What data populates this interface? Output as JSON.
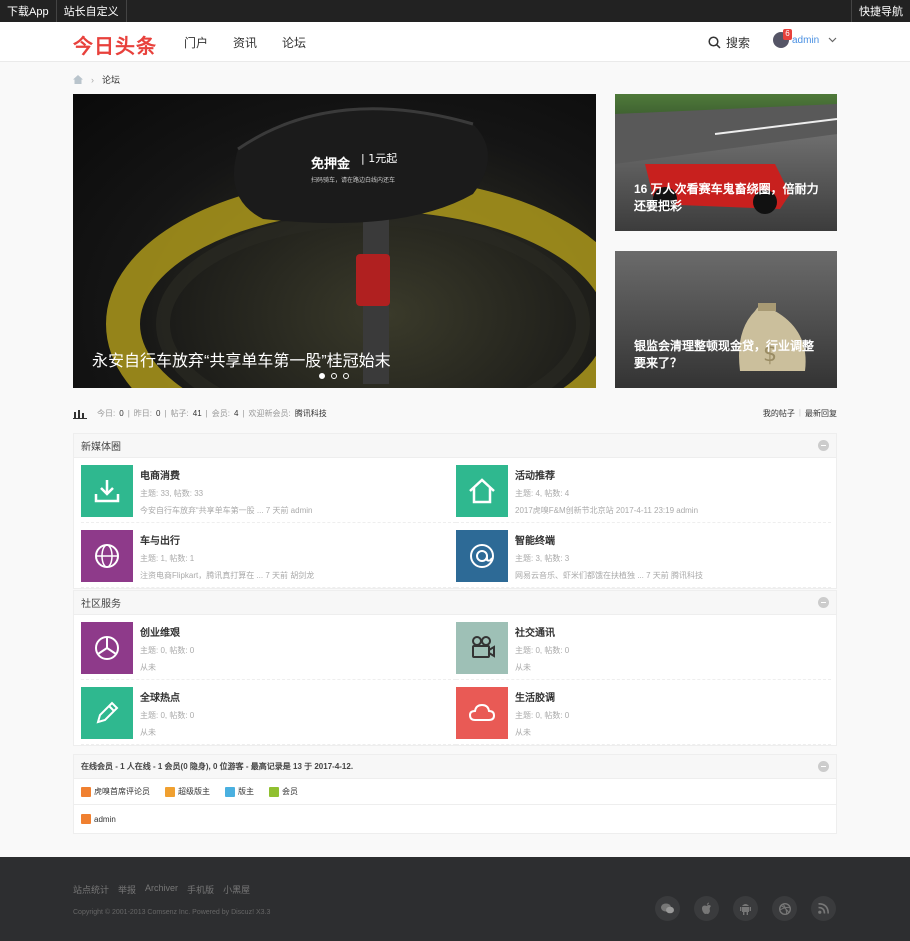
{
  "topbar": {
    "download": "下载App",
    "custom": "站长自定义",
    "quicknav": "快捷导航"
  },
  "header": {
    "logo": "今日头条",
    "nav": [
      "门户",
      "资讯",
      "论坛"
    ],
    "search": "搜索",
    "user": "admin",
    "notice_count": "6"
  },
  "breadcrumb": {
    "current": "论坛"
  },
  "slider": {
    "title": "永安自行车放弃“共享单车第一股”桂冠始末",
    "slide_count": 3,
    "active": 1
  },
  "side_news": [
    {
      "title": "16 万人次看赛车鬼畜绕圈，倍耐力还要把彩"
    },
    {
      "title": "银监会清理整顿现金贷，行业调整要来了？"
    }
  ],
  "stats": {
    "today_label": "今日:",
    "today": "0",
    "yesterday_label": "昨日:",
    "yesterday": "0",
    "posts_label": "帖子:",
    "posts": "41",
    "members_label": "会员:",
    "members": "4",
    "welcome_label": "欢迎新会员:",
    "newest": "腾讯科技",
    "my_posts": "我的帖子",
    "latest": "最新回复"
  },
  "categories": [
    {
      "title": "新媒体圈",
      "forums": [
        {
          "name": "电商消费",
          "meta": "主题: 33, 帖数: 33",
          "last": "今安自行车放弃“共享单车第一股 ... 7 天前 admin",
          "color": "#2fb88f",
          "icon": "download-icon"
        },
        {
          "name": "活动推荐",
          "meta": "主题: 4, 帖数: 4",
          "last": "2017虎嗅F&M创新节北京站 2017-4-11 23:19 admin",
          "color": "#2fb88f",
          "icon": "home-icon"
        },
        {
          "name": "车与出行",
          "meta": "主题: 1, 帖数: 1",
          "last": "注资电商Flipkart，腾讯真打算在 ... 7 天前 胡剑龙",
          "color": "#8e3a8a",
          "icon": "globe-icon"
        },
        {
          "name": "智能终端",
          "meta": "主题: 3, 帖数: 3",
          "last": "网易云音乐、虾米们都饿在扶植独 ... 7 天前 腾讯科技",
          "color": "#2d6a96",
          "icon": "at-icon"
        }
      ]
    },
    {
      "title": "社区服务",
      "forums": [
        {
          "name": "创业维艰",
          "meta": "主题: 0, 帖数: 0",
          "last": "从未",
          "color": "#8e3a8a",
          "icon": "pie-icon"
        },
        {
          "name": "社交通讯",
          "meta": "主题: 0, 帖数: 0",
          "last": "从未",
          "color": "#9ec0b6",
          "icon": "camera-icon"
        },
        {
          "name": "全球热点",
          "meta": "主题: 0, 帖数: 0",
          "last": "从未",
          "color": "#2fb88f",
          "icon": "pencil-icon"
        },
        {
          "name": "生活胶调",
          "meta": "主题: 0, 帖数: 0",
          "last": "从未",
          "color": "#e95a55",
          "icon": "cloud-icon"
        }
      ]
    }
  ],
  "online": {
    "header": "在线会员 - 1 人在线 - 1 会员(0 隐身), 0 位游客 - 最高记录是 13 于 2017-4-12.",
    "legend": [
      {
        "label": "虎嗅首席评论员",
        "color": "#f08030"
      },
      {
        "label": "超级版主",
        "color": "#f0a030"
      },
      {
        "label": "版主",
        "color": "#4ab0e0"
      },
      {
        "label": "会员",
        "color": "#90c030"
      }
    ],
    "users": [
      "admin"
    ]
  },
  "footer": {
    "links": [
      "站点统计",
      "举报",
      "Archiver",
      "手机版",
      "小黑屋"
    ],
    "copyright": "Copyright © 2001-2013 Comsenz Inc. Powered by Discuz! X3.3",
    "social": [
      "wechat-icon",
      "apple-icon",
      "android-icon",
      "dribbble-icon",
      "rss-icon"
    ]
  }
}
